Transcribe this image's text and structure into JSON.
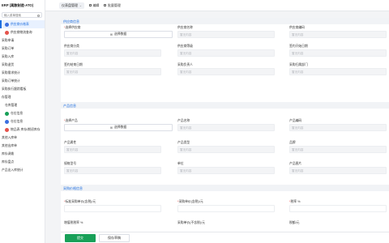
{
  "app": {
    "title": "ERP (离散制造-ATO)"
  },
  "sidebar": {
    "search_placeholder": "输入菜单搜索",
    "items": [
      {
        "label": "供应商价格表",
        "dot": "#3b6fe0",
        "active": true,
        "indent": true
      },
      {
        "label": "供应商物流查询",
        "dot": "#e5534b",
        "indent": true
      },
      {
        "label": "采购申请"
      },
      {
        "label": "采购订单"
      },
      {
        "label": "采购入库"
      },
      {
        "label": "采购退货"
      },
      {
        "label": "采购需求统计"
      },
      {
        "label": "采购订单统计"
      },
      {
        "label": "采购执行跟踪看板"
      },
      {
        "label": "存管理"
      },
      {
        "label": "仓库管理",
        "indent": true
      },
      {
        "label": "仓位信息",
        "dot": "#18a058",
        "indent": true
      },
      {
        "label": "仓位信息",
        "dot": "#3b6fe0",
        "indent": true
      },
      {
        "label": "物品表·库存/期初库存",
        "dot": "#e5534b",
        "indent": true
      },
      {
        "label": "其他入库单"
      },
      {
        "label": "其他出库单"
      },
      {
        "label": "库存调拨"
      },
      {
        "label": "库存盘点"
      },
      {
        "label": "产品出入库统计"
      }
    ]
  },
  "topbar": {
    "tab": "仪表盘管理",
    "chevron": "⌄",
    "edit": "编辑",
    "remove": "批量管理"
  },
  "sections": {
    "supplier": "供应商信息",
    "product": "产品信息",
    "pricing": "采购价格信息"
  },
  "supplier_fields": {
    "supplier_label": "选择供应商",
    "supplier_btn": "选择数据",
    "name_label": "供应商名称",
    "name_ph": "暂无内容",
    "code_label": "供应商编码",
    "code_ph": "暂无内容",
    "type_label": "供应商分类",
    "type_ph": "暂无内容",
    "level_label": "供应商等级",
    "level_ph": "暂无内容",
    "start_label": "签约开始日期",
    "start_ph": "暂无内容",
    "end_label": "签约结束日期",
    "end_ph": "暂无内容",
    "owner_label": "采购负责人",
    "owner_ph": "暂无内容",
    "dept_label": "采购归属部门",
    "dept_ph": "暂无内容"
  },
  "product_fields": {
    "product_label": "选择产品",
    "product_btn": "选择数据",
    "pname_label": "产品名称",
    "pname_ph": "暂无内容",
    "pcode_label": "产品编码",
    "pcode_ph": "暂无内容",
    "attr_label": "产品属性",
    "attr_ph": "暂无内容",
    "ptype_label": "产品类型",
    "ptype_ph": "暂无内容",
    "brand_label": "品牌",
    "brand_ph": "暂无内容",
    "spec_label": "规格型号",
    "spec_ph": "暂无内容",
    "unit_label": "单位",
    "unit_ph": "暂无内容",
    "img_label": "产品图片",
    "img_ph": "暂无内容"
  },
  "pricing_fields": {
    "std_price_label": "标准采购单价(含税)/元",
    "unit_price_label": "采购单价(含税)/元",
    "tax_label": "税率 %",
    "adj_label": "增值税税率 %",
    "no_tax_label": "采购单价(不含税)/元",
    "tax_amt_label": "税额/元"
  },
  "footer": {
    "submit": "提交",
    "draft": "保存草稿"
  },
  "colors": {
    "accent": "#1f6fe0",
    "submit": "#18a058"
  }
}
